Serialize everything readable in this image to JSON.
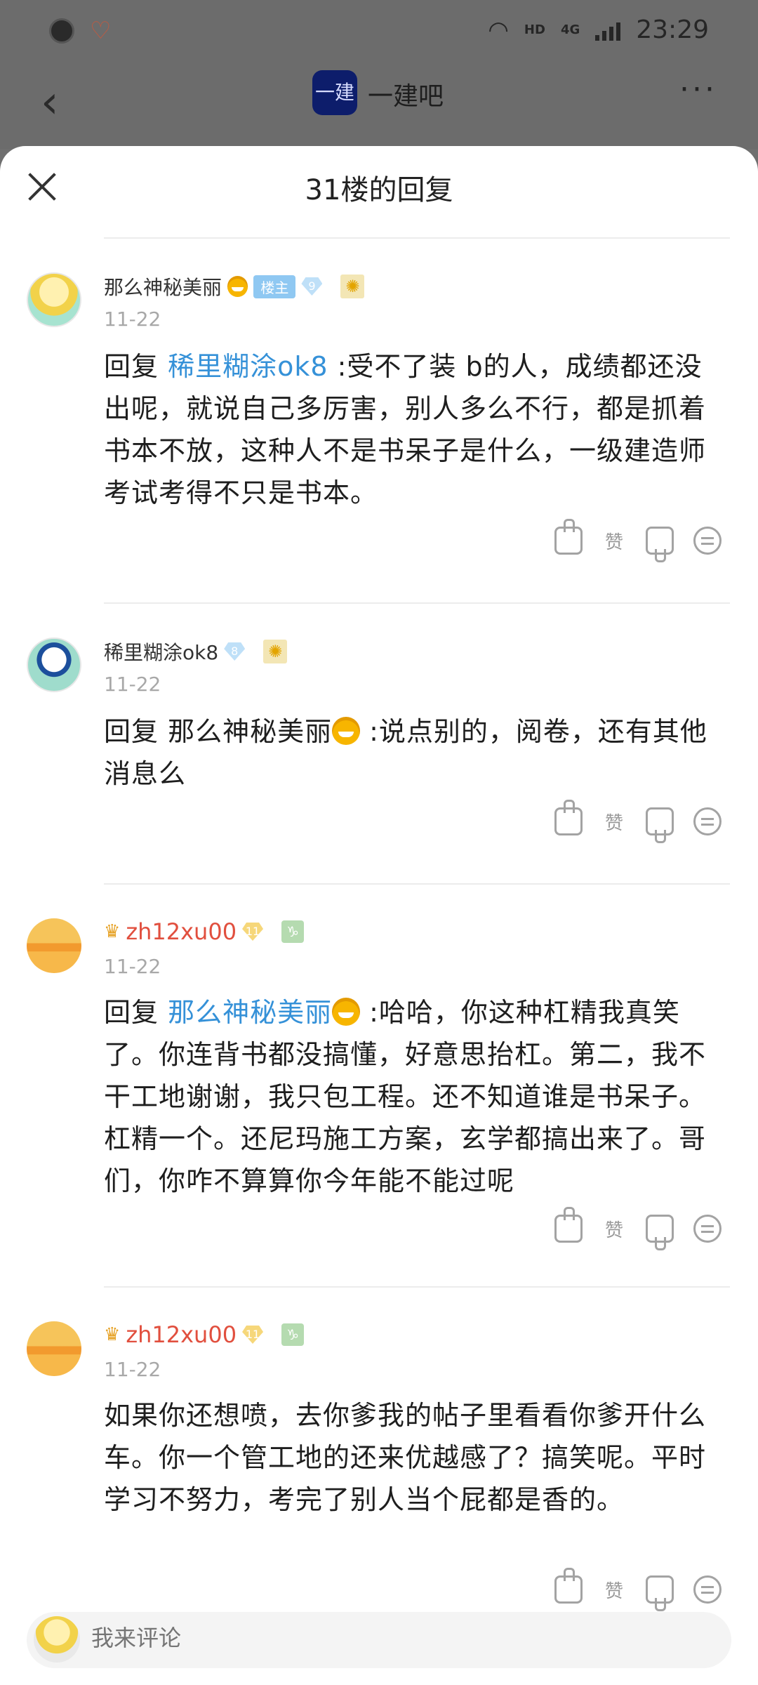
{
  "status_bar": {
    "time": "23:29",
    "network": "HD",
    "signal_type": "4G"
  },
  "nav": {
    "forum_avatar_text": "一建",
    "forum_name": "一建吧"
  },
  "sheet": {
    "title": "31楼的回复"
  },
  "replies": [
    {
      "username": "那么神秘美丽",
      "owner_badge": "楼主",
      "level": "9",
      "date": "11-22",
      "reply_prefix": "回复",
      "mention": "稀里糊涂ok8",
      "text": " :受不了装 b的人，成绩都还没出呢，就说自己多厉害，别人多么不行，都是抓着书本不放，这种人不是书呆子是什么，一级建造师考试考得不只是书本。",
      "like_label": "赞"
    },
    {
      "username": "稀里糊涂ok8",
      "level": "8",
      "date": "11-22",
      "reply_prefix": "回复 ",
      "mention": "那么神秘美丽",
      "text": " :说点别的，阅卷，还有其他消息么",
      "like_label": "赞"
    },
    {
      "username": "zh12xu00",
      "level": "11",
      "date": "11-22",
      "reply_prefix": "回复",
      "mention": "那么神秘美丽",
      "text": " :哈哈，你这种杠精我真笑了。你连背书都没搞懂，好意思抬杠。第二，我不干工地谢谢，我只包工程。还不知道谁是书呆子。杠精一个。还尼玛施工方案，玄学都搞出来了。哥们，你咋不算算你今年能不能过呢",
      "like_label": "赞"
    },
    {
      "username": "zh12xu00",
      "level": "11",
      "date": "11-22",
      "text": "如果你还想喷，去你爹我的帖子里看看你爹开什么车。你一个管工地的还来优越感了？搞笑呢。平时学习不努力，考完了别人当个屁都是香的。",
      "like_label": "赞"
    }
  ],
  "comment_bar": {
    "placeholder": "我来评论"
  }
}
